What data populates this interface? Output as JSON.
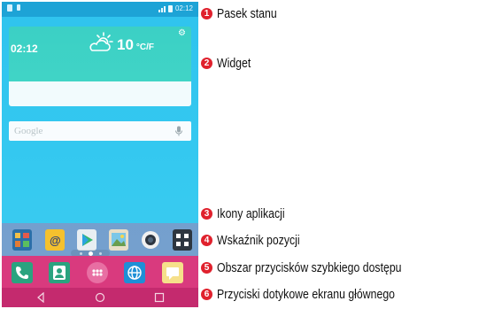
{
  "status_bar": {
    "time": "02:12"
  },
  "widget": {
    "time": "02:12",
    "temperature": "10",
    "unit": "°C/F",
    "weather_icon": "partly-cloudy-icon"
  },
  "search": {
    "text": "Google"
  },
  "apps": [
    {
      "name": "tools-folder-icon",
      "color": "#2b6fa8"
    },
    {
      "name": "email-icon",
      "color": "#f4c12e"
    },
    {
      "name": "play-store-icon",
      "color": "#e8eef2"
    },
    {
      "name": "gallery-icon",
      "color": "#e9dfc7"
    },
    {
      "name": "camera-icon",
      "color": "#f0f0f0"
    },
    {
      "name": "apps-folder-icon",
      "color": "#2d3640"
    }
  ],
  "dock": [
    {
      "name": "phone-icon",
      "color": "#2aa37f"
    },
    {
      "name": "contacts-icon",
      "color": "#2aa37f"
    },
    {
      "name": "apps-drawer-icon",
      "color": "#e86fa3"
    },
    {
      "name": "browser-icon",
      "color": "#1e8fd6"
    },
    {
      "name": "messaging-icon",
      "color": "#f6e08a"
    }
  ],
  "callouts": [
    {
      "num": "1",
      "label": "Pasek stanu"
    },
    {
      "num": "2",
      "label": "Widget"
    },
    {
      "num": "3",
      "label": "Ikony aplikacji"
    },
    {
      "num": "4",
      "label": "Wskaźnik pozycji"
    },
    {
      "num": "5",
      "label": "Obszar przycisków szybkiego dostępu"
    },
    {
      "num": "6",
      "label": "Przyciski dotykowe ekranu głównego"
    }
  ],
  "colors": {
    "accent_red": "#e0212d",
    "sky": "#35c9f0",
    "pink": "#d93a7e"
  }
}
